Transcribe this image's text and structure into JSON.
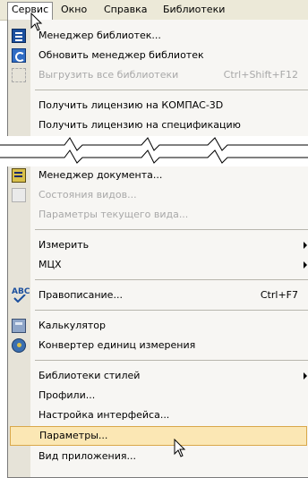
{
  "menubar": {
    "items": [
      {
        "label": "Сервис",
        "active": true
      },
      {
        "label": "Окно",
        "active": false
      },
      {
        "label": "Справка",
        "active": false
      },
      {
        "label": "Библиотеки",
        "active": false
      }
    ]
  },
  "menu": {
    "lib_manager": "Менеджер библиотек...",
    "update_lib_manager": "Обновить менеджер библиотек",
    "unload_all": "Выгрузить все библиотеки",
    "unload_all_shortcut": "Ctrl+Shift+F12",
    "license_kompas": "Получить лицензию на КОМПАС-3D",
    "license_spec": "Получить лицензию на спецификацию",
    "doc_manager": "Менеджер документа...",
    "view_states": "Состояния видов...",
    "view_params": "Параметры текущего вида...",
    "measure": "Измерить",
    "mch": "МЦХ",
    "spelling": "Правописание...",
    "spelling_shortcut": "Ctrl+F7",
    "calculator": "Калькулятор",
    "unit_converter": "Конвертер единиц измерения",
    "style_libs": "Библиотеки стилей",
    "profiles": "Профили...",
    "ui_settings": "Настройка интерфейса...",
    "parameters": "Параметры...",
    "app_view": "Вид приложения..."
  },
  "icons": {
    "spell_text": "ABC"
  }
}
